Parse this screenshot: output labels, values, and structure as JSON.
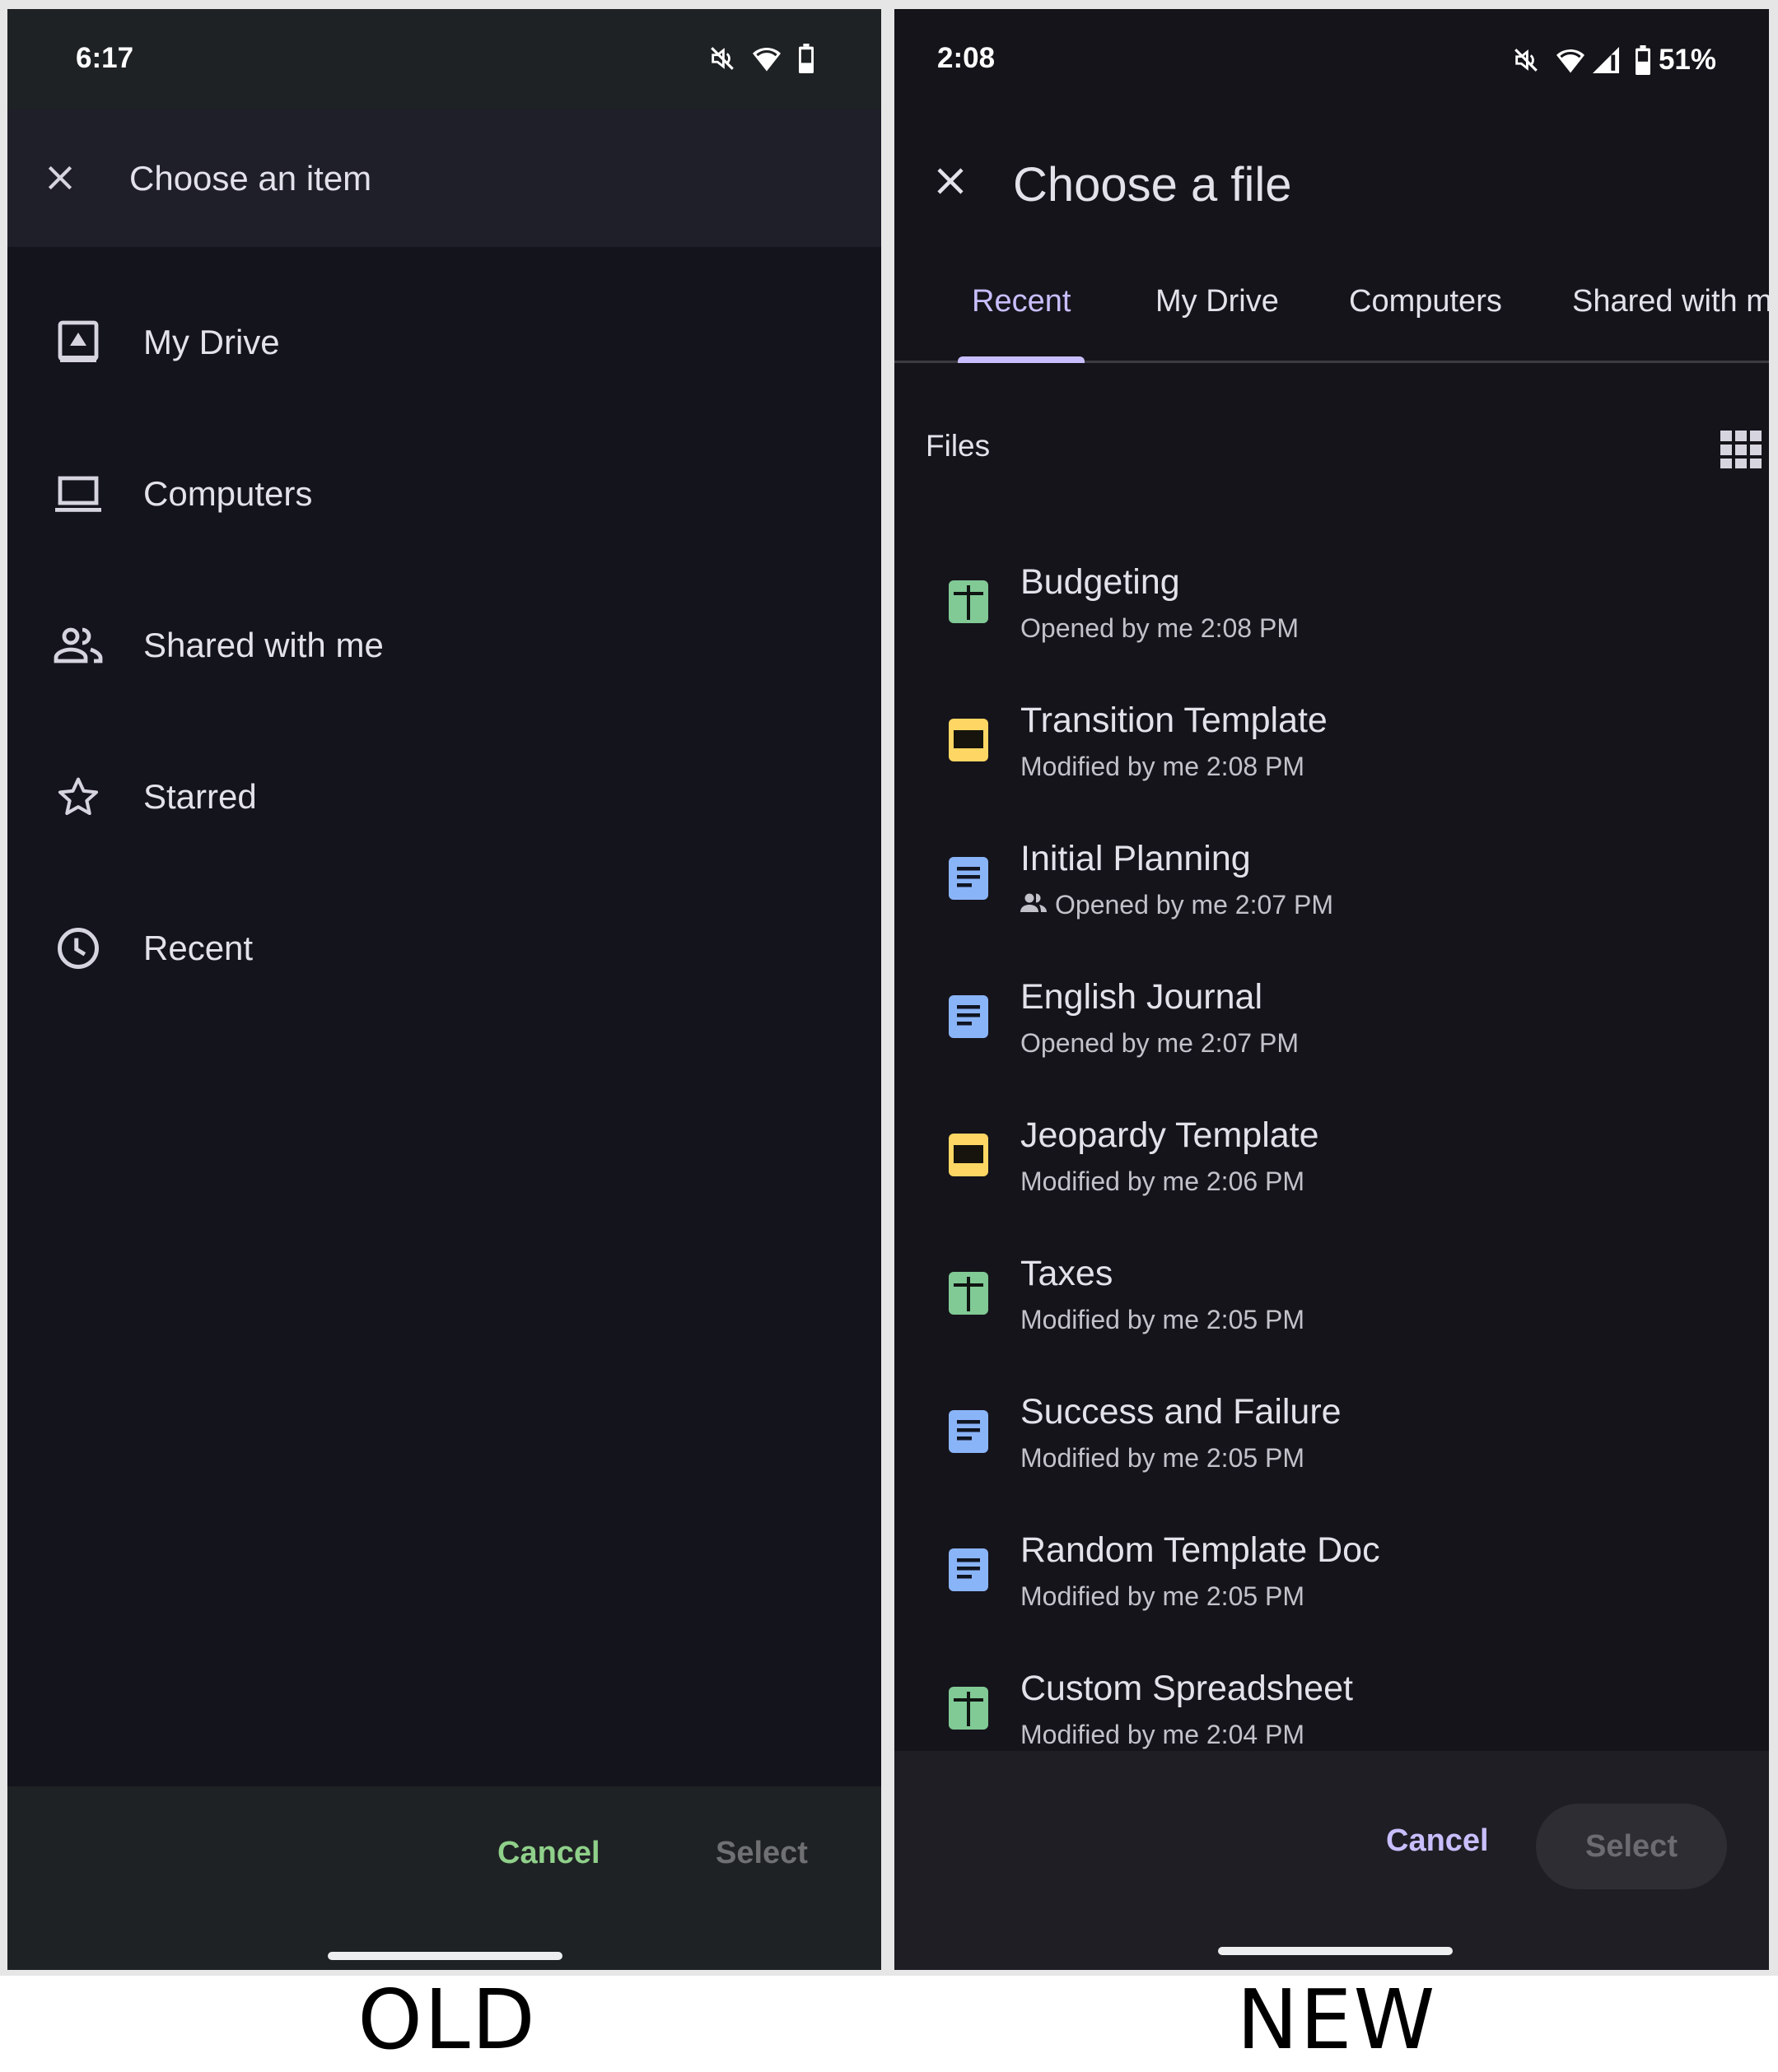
{
  "captions": {
    "old": "OLD",
    "new": "NEW"
  },
  "old": {
    "status": {
      "time": "6:17",
      "icons": [
        "mute-icon",
        "wifi-icon",
        "battery-icon"
      ]
    },
    "header": {
      "title": "Choose an item",
      "close_icon": "close-icon"
    },
    "nav_items": [
      {
        "label": "My Drive",
        "icon": "drive-icon"
      },
      {
        "label": "Computers",
        "icon": "laptop-icon"
      },
      {
        "label": "Shared with me",
        "icon": "people-icon"
      },
      {
        "label": "Starred",
        "icon": "star-icon"
      },
      {
        "label": "Recent",
        "icon": "clock-icon"
      }
    ],
    "footer": {
      "cancel": "Cancel",
      "select": "Select"
    },
    "colors": {
      "cancel": "#8fd08a",
      "select_disabled": "#6e7072"
    }
  },
  "new": {
    "status": {
      "time": "2:08",
      "battery": "51%",
      "icons": [
        "mute-icon",
        "wifi-icon",
        "signal-icon",
        "battery-icon"
      ]
    },
    "header": {
      "title": "Choose a file",
      "close_icon": "close-icon"
    },
    "tabs": [
      {
        "label": "Recent",
        "active": true
      },
      {
        "label": "My Drive",
        "active": false
      },
      {
        "label": "Computers",
        "active": false
      },
      {
        "label": "Shared with me",
        "active": false
      }
    ],
    "files_section": {
      "label": "Files",
      "view_toggle_icon": "grid-view-icon"
    },
    "files": [
      {
        "name": "Budgeting",
        "meta": "Opened by me 2:08 PM",
        "type": "sheets",
        "shared": false
      },
      {
        "name": "Transition Template",
        "meta": "Modified by me 2:08 PM",
        "type": "slides",
        "shared": false
      },
      {
        "name": "Initial Planning",
        "meta": "Opened by me 2:07 PM",
        "type": "docs",
        "shared": true
      },
      {
        "name": "English Journal",
        "meta": "Opened by me 2:07 PM",
        "type": "docs",
        "shared": false
      },
      {
        "name": "Jeopardy Template",
        "meta": "Modified by me 2:06 PM",
        "type": "slides",
        "shared": false
      },
      {
        "name": "Taxes",
        "meta": "Modified by me 2:05 PM",
        "type": "sheets",
        "shared": false
      },
      {
        "name": "Success and Failure",
        "meta": "Modified by me 2:05 PM",
        "type": "docs",
        "shared": false
      },
      {
        "name": "Random Template Doc",
        "meta": "Modified by me 2:05 PM",
        "type": "docs",
        "shared": false
      },
      {
        "name": "Custom Spreadsheet",
        "meta": "Modified by me 2:04 PM",
        "type": "sheets",
        "shared": false
      }
    ],
    "footer": {
      "cancel": "Cancel",
      "select": "Select"
    },
    "colors": {
      "accent": "#c9beff",
      "sheets": "#81c995",
      "slides": "#fdd663",
      "docs": "#8ab4f8"
    }
  }
}
